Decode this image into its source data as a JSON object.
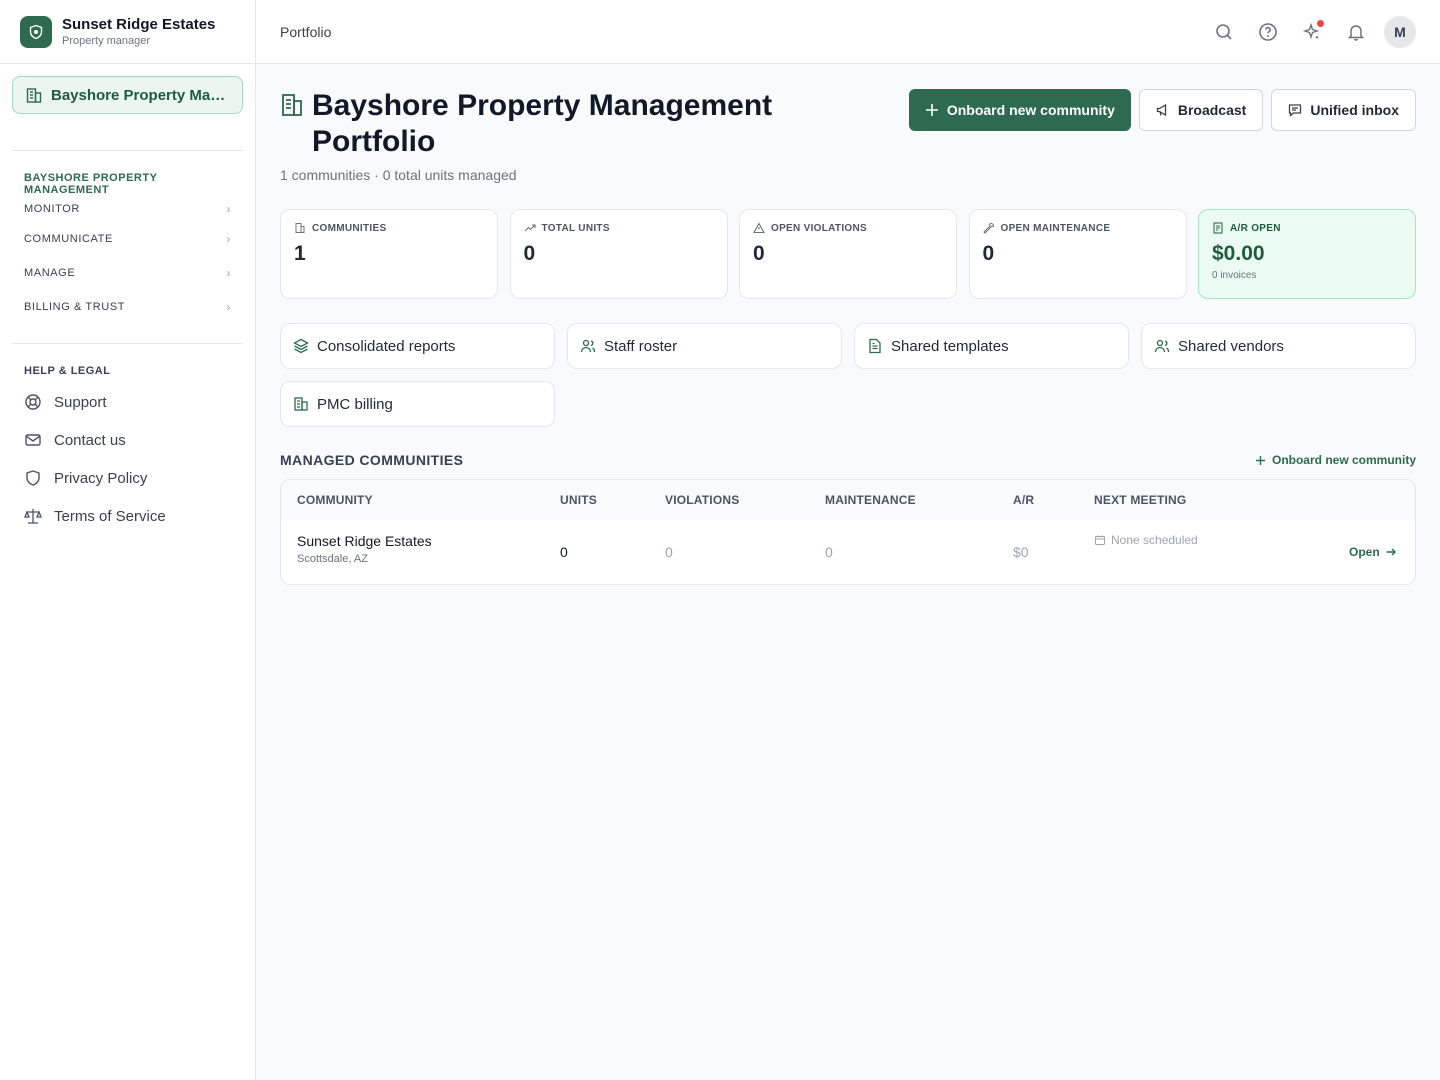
{
  "sidebar": {
    "brand_name": "Sunset Ridge Estates",
    "brand_role": "Property manager",
    "org_switch_label": "Bayshore Property Man...",
    "section_title": "BAYSHORE PROPERTY MANAGEMENT",
    "nav": [
      "MONITOR",
      "COMMUNICATE",
      "MANAGE",
      "BILLING & TRUST"
    ],
    "help_title": "HELP & LEGAL",
    "help_items": [
      "Support",
      "Contact us",
      "Privacy Policy",
      "Terms of Service"
    ]
  },
  "topbar": {
    "breadcrumb": "Portfolio",
    "avatar_initial": "M",
    "icons": [
      "search-icon",
      "help-icon",
      "sparkles-icon",
      "bell-icon"
    ]
  },
  "header": {
    "title_line1": "Bayshore Property Management",
    "title_line2": "Portfolio",
    "subtitle": "1 communities · 0 total units managed",
    "primary_button": "Onboard new community",
    "broadcast_button": "Broadcast",
    "inbox_button": "Unified inbox"
  },
  "stats": [
    {
      "label": "COMMUNITIES",
      "value": "1"
    },
    {
      "label": "TOTAL UNITS",
      "value": "0"
    },
    {
      "label": "OPEN VIOLATIONS",
      "value": "0"
    },
    {
      "label": "OPEN MAINTENANCE",
      "value": "0"
    },
    {
      "label": "A/R OPEN",
      "value": "$0.00",
      "sub": "0 invoices"
    }
  ],
  "quick_links": [
    "Consolidated reports",
    "Staff roster",
    "Shared templates",
    "Shared vendors",
    "PMC billing"
  ],
  "communities": {
    "title": "MANAGED COMMUNITIES",
    "action": "Onboard new community",
    "columns": [
      "COMMUNITY",
      "UNITS",
      "VIOLATIONS",
      "MAINTENANCE",
      "A/R",
      "NEXT MEETING"
    ],
    "rows": [
      {
        "name": "Sunset Ridge Estates",
        "location": "Scottsdale, AZ",
        "units": "0",
        "violations": "0",
        "maintenance": "0",
        "ar": "$0",
        "next_meeting": "None scheduled",
        "open_label": "Open"
      }
    ]
  },
  "colors": {
    "brand": "#2d6a4f",
    "accent_bg": "#ecfbf2",
    "alert": "#ef4444"
  }
}
